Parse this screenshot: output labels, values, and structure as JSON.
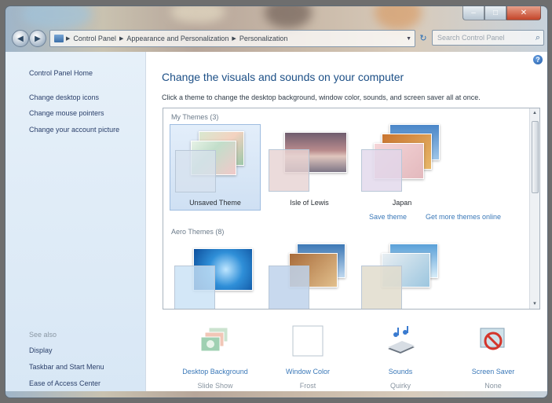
{
  "address": {
    "crumbs": [
      "Control Panel",
      "Appearance and Personalization",
      "Personalization"
    ],
    "search_placeholder": "Search Control Panel"
  },
  "sidebar": {
    "home": "Control Panel Home",
    "links": [
      "Change desktop icons",
      "Change mouse pointers",
      "Change your account picture"
    ],
    "see_also_heading": "See also",
    "see_also": [
      "Display",
      "Taskbar and Start Menu",
      "Ease of Access Center"
    ]
  },
  "main": {
    "title": "Change the visuals and sounds on your computer",
    "subtitle": "Click a theme to change the desktop background, window color, sounds, and screen saver all at once.",
    "my_themes_label": "My Themes (3)",
    "my_themes": [
      {
        "name": "Unsaved Theme",
        "selected": true
      },
      {
        "name": "Isle of Lewis",
        "selected": false
      },
      {
        "name": "Japan",
        "selected": false
      }
    ],
    "save_theme": "Save theme",
    "get_more": "Get more themes online",
    "aero_themes_label": "Aero Themes (8)",
    "bottom": [
      {
        "label": "Desktop Background",
        "value": "Slide Show",
        "icon": "desktop-background-icon"
      },
      {
        "label": "Window Color",
        "value": "Frost",
        "icon": "window-color-icon"
      },
      {
        "label": "Sounds",
        "value": "Quirky",
        "icon": "sounds-icon"
      },
      {
        "label": "Screen Saver",
        "value": "None",
        "icon": "screen-saver-icon"
      }
    ]
  },
  "colors": {
    "link": "#3a78b8",
    "title": "#1c4f86",
    "sidebar_bg": "#dde9f6",
    "selection": "#cfe0f3"
  }
}
